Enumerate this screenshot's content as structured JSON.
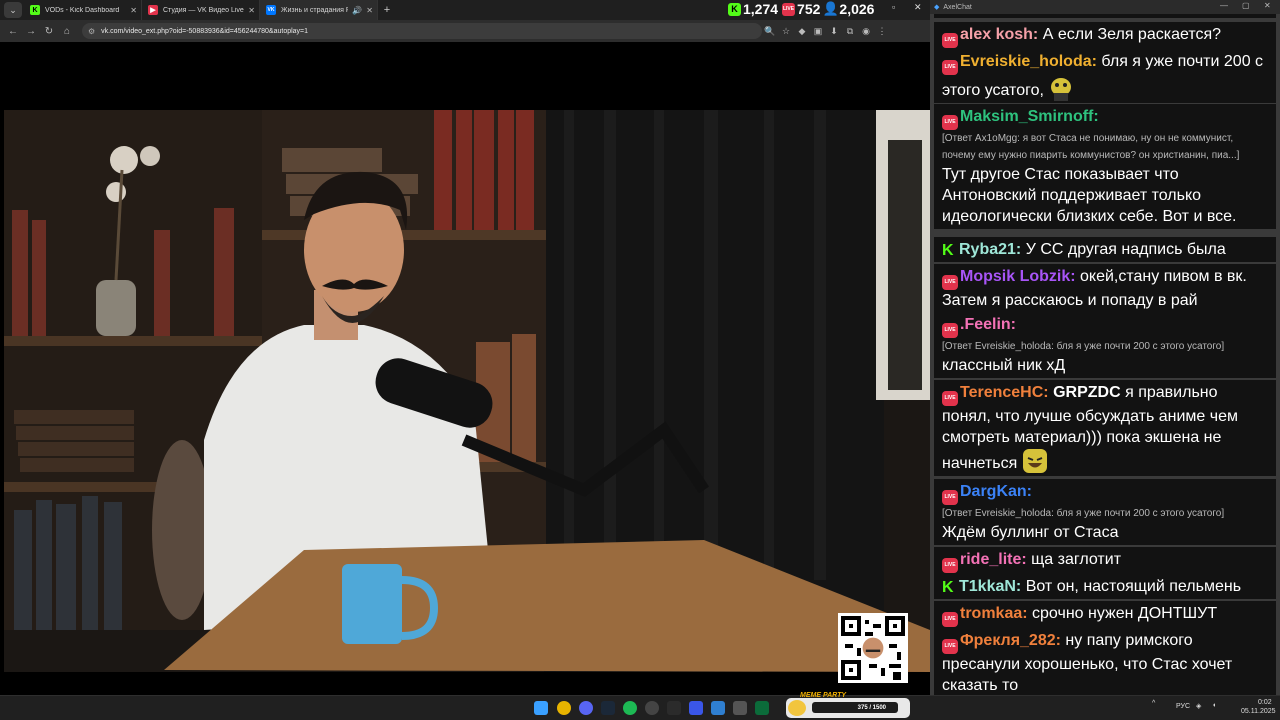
{
  "browser": {
    "tabs": [
      {
        "title": "VODs - Kick Dashboard",
        "icon": "kick-icon",
        "color": "#53fc18",
        "letter": "K"
      },
      {
        "title": "Студия — VK Видео Live",
        "icon": "vk-live-icon",
        "color": "#e2334c",
        "letter": "▶"
      },
      {
        "title": "Жизнь и страдания Роман…",
        "icon": "vk-icon",
        "color": "#0077ff",
        "letter": "VK",
        "active": true
      }
    ],
    "url": "vk.com/video_ext.php?oid=-50883936&id=456244780&autoplay=1",
    "counters": {
      "kick": "1,274",
      "vk_live": "752",
      "viewers": "2,026"
    }
  },
  "chat": {
    "window_title": "AxelChat",
    "messages": [
      {
        "platform": "vk",
        "user": "alex kosh:",
        "color": "#f5a0a8",
        "text": "А если Зеля раскается?"
      },
      {
        "platform": "vk",
        "user": "Evreiskie_holoda:",
        "color": "#f0b030",
        "text": "бля я уже почти 200 с этого усатого,",
        "emote": "pepe-emote"
      },
      {
        "platform": "vk",
        "user": "Maksim_Smirnoff:",
        "color": "#2ec27e",
        "reply": "[Ответ Ax1oMgg: я вот Стаса не понимаю, ну он не коммунист, почему ему нужно пиарить коммунистов? он христианин, пиа...]",
        "text": "Тут другое Стас показывает что Антоновский поддерживает только идеологически близких себе. Вот и все."
      },
      {
        "platform": "kick",
        "user": "Ryba21:",
        "color": "#9fe7d8",
        "text": "У СС другая надпись была"
      },
      {
        "platform": "vk",
        "user": "Mopsik Lobzik:",
        "color": "#a855f7",
        "text": "окей,стану пивом в вк. Затем я расскаюсь и попаду в рай"
      },
      {
        "platform": "vk",
        "user": ".Feelin:",
        "color": "#f472b6",
        "reply": "[Ответ Evreiskie_holoda: бля я уже почти 200 с этого усатого]",
        "text": "классный ник хД"
      },
      {
        "platform": "vk",
        "user": "TerenceHC:",
        "color": "#f0803c",
        "mention": "GRPZDC",
        "text": "я правильно понял, что лучше обсуждать аниме чем смотреть материал))) пока экшена не начнеться",
        "emote": "laugh-emote"
      },
      {
        "platform": "vk",
        "user": "DargKan:",
        "color": "#3b82f6",
        "reply": "[Ответ Evreiskie_holoda: бля я уже почти 200 с этого усатого]",
        "text": "Ждём буллинг от Стаса"
      },
      {
        "platform": "vk",
        "user": "ride_lite:",
        "color": "#f472b6",
        "text": "ща заглотит"
      },
      {
        "platform": "kick",
        "user": "T1kkaN:",
        "color": "#9fe7d8",
        "text": "Вот он, настоящий пельмень"
      },
      {
        "platform": "vk",
        "user": "tromkaa:",
        "color": "#f0803c",
        "text": "срочно нужен ДОНТШУТ"
      },
      {
        "platform": "vk",
        "user": "Фрекля_282:",
        "color": "#f0803c",
        "text": "ну папу римского пресанули хорошенько, что Стас хочет сказать то"
      }
    ]
  },
  "video": {
    "mug_color": "#4fa8d8",
    "shirt_color": "#e8e8e6",
    "table_color": "#9a6b3e"
  },
  "taskbar": {
    "meme_title": "MEME PARTY",
    "meme_progress": "375 / 1500",
    "lang": "РУС",
    "time": "0:02",
    "date": "05.11.2025"
  }
}
